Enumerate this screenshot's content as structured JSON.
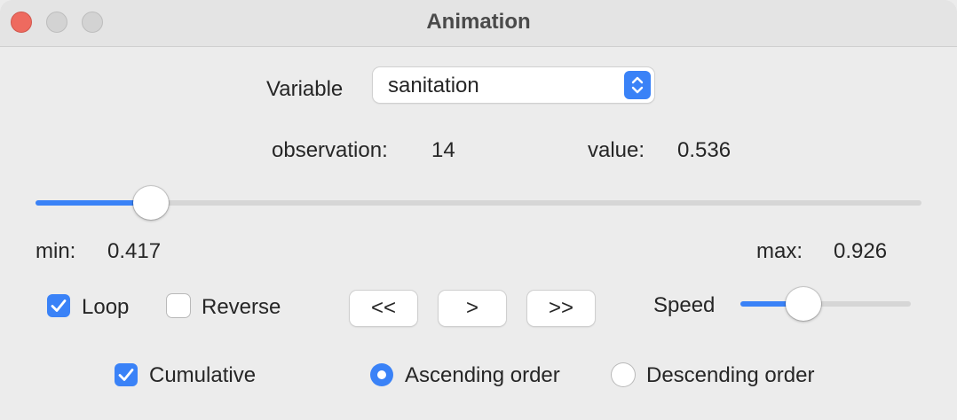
{
  "window": {
    "title": "Animation"
  },
  "variable": {
    "label": "Variable",
    "selected": "sanitation"
  },
  "observation": {
    "label": "observation:",
    "value": "14"
  },
  "value": {
    "label": "value:",
    "value": "0.536"
  },
  "position_slider": {
    "level": 0.13
  },
  "range": {
    "min_label": "min:",
    "min_value": "0.417",
    "max_label": "max:",
    "max_value": "0.926"
  },
  "loop": {
    "label": "Loop",
    "checked": true
  },
  "reverse": {
    "label": "Reverse",
    "checked": false
  },
  "controls": {
    "rewind_label": "<<",
    "play_label": ">",
    "forward_label": ">>"
  },
  "speed": {
    "label": "Speed",
    "level": 0.37
  },
  "cumulative": {
    "label": "Cumulative",
    "checked": true
  },
  "order": {
    "ascending_label": "Ascending order",
    "descending_label": "Descending order",
    "selected": "ascending"
  },
  "colors": {
    "accent": "#3a82f7",
    "close": "#ee6a5f"
  }
}
